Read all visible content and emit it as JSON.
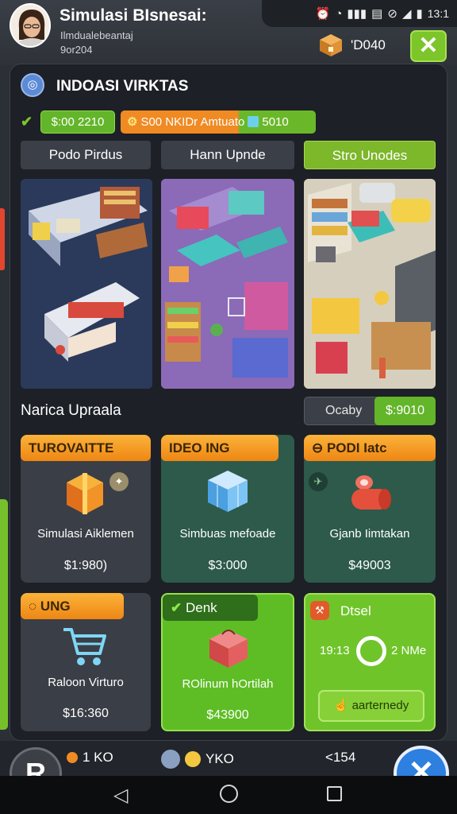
{
  "header": {
    "title": "Simulasi BIsnesai:",
    "subtitle1": "Ilmdualebeantaj",
    "subtitle2": "9or204",
    "coins": "'D040",
    "close_label": "✕"
  },
  "status_bar": {
    "icons": [
      "alarm-icon",
      "clock-icon",
      "signal-icon",
      "sd-card-icon",
      "mute-icon",
      "wifi-icon",
      "battery-icon"
    ],
    "time": "13:1"
  },
  "panel": {
    "title": "INDOASI VIRKTAS",
    "money": "$:00 2210",
    "bonus_prefix": "S00 NKIDr Amtuato",
    "bonus_value": "5010"
  },
  "tabs": [
    {
      "label": "Podo Pirdus"
    },
    {
      "label": "Hann Upnde"
    },
    {
      "label": "Stro Unodes"
    }
  ],
  "upgrades_section": {
    "title": "Narica Upraala",
    "filter_label": "Ocaby",
    "filter_price": "$:9010"
  },
  "cards": [
    {
      "banner": "TUROVAITTE",
      "name": "Simulasi Aiklemen",
      "price": "$1:980)"
    },
    {
      "banner": "IDEO ING",
      "name": "Simbuas mefoade",
      "price": "$3:000"
    },
    {
      "banner": "⊖ PODI Iatc",
      "name": "Gjanb Iimtakan",
      "price": "$49003"
    },
    {
      "banner": "UNG",
      "name": "Raloon Virturo",
      "price": "$16:360"
    },
    {
      "banner": "Denk",
      "name": "ROlinum hOrtilah",
      "price": "$43900"
    },
    {
      "banner": "Dtsel",
      "timer_left": "19:13",
      "timer_right": "2 NMe",
      "button": "aarternedy"
    }
  ],
  "bottom_bar": {
    "item1": "1 KO",
    "item2": "YKO",
    "item3": "<154",
    "left_button": "R",
    "right_button": "✕"
  },
  "colors": {
    "accent_green": "#7cc52a",
    "accent_orange": "#f08a23",
    "panel_bg": "#1d2026",
    "primary_blue": "#2d7fe0"
  }
}
